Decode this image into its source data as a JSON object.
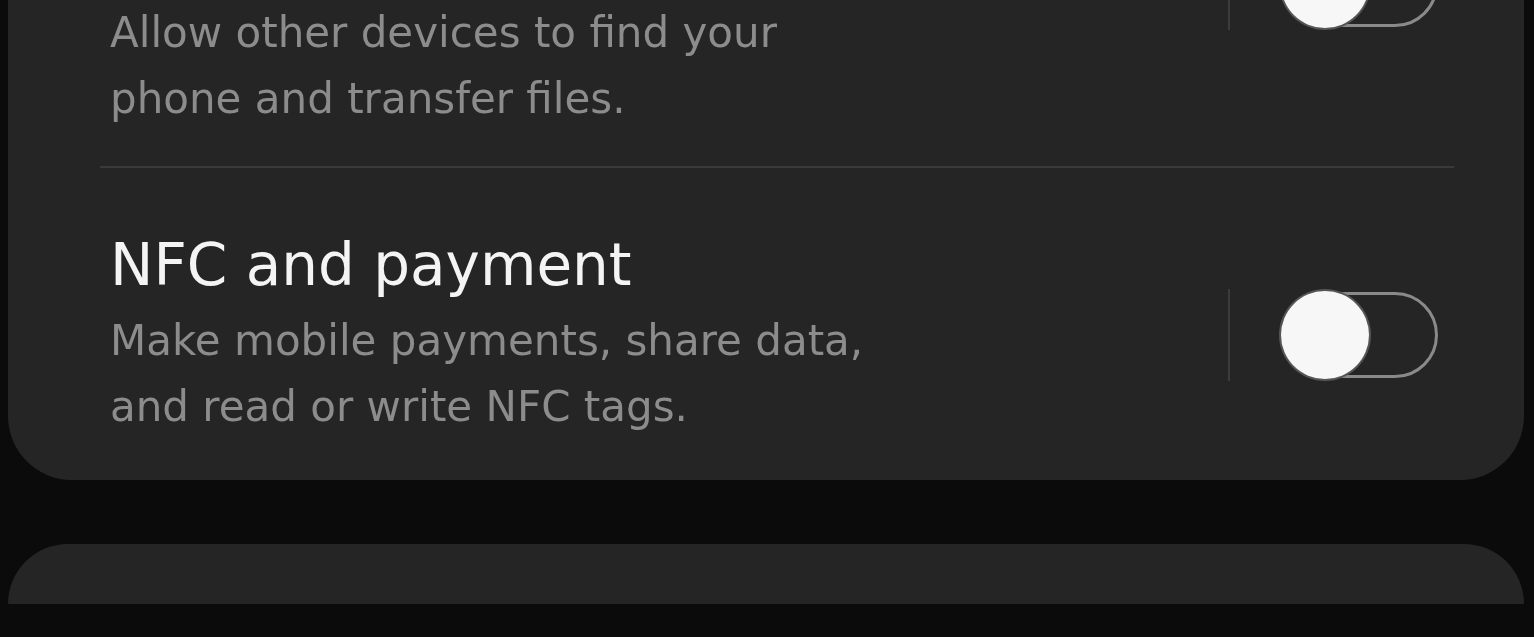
{
  "settings": [
    {
      "description": "Allow other devices to find your phone and transfer files.",
      "on": false
    },
    {
      "title": "NFC and payment",
      "description": "Make mobile payments, share data, and read or write NFC tags.",
      "on": false
    }
  ]
}
